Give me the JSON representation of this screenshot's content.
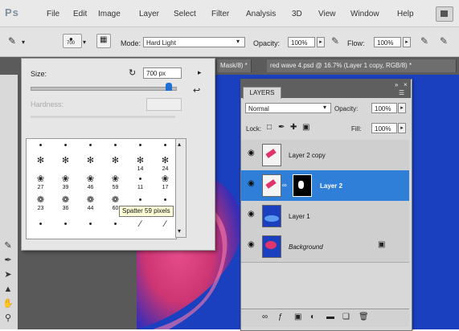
{
  "menu": {
    "logo": "Ps",
    "items": [
      "File",
      "Edit",
      "Image",
      "Layer",
      "Select",
      "Filter",
      "Analysis",
      "3D",
      "View",
      "Window",
      "Help"
    ]
  },
  "options": {
    "brush_size_small": "700",
    "mode_label": "Mode:",
    "mode_value": "Hard Light",
    "opacity_label": "Opacity:",
    "opacity_value": "100%",
    "flow_label": "Flow:",
    "flow_value": "100%"
  },
  "tabs": {
    "doc1": "Mask/8) *",
    "doc2": "red wave 4.psd @ 16.7% (Layer 1 copy, RGB/8) *"
  },
  "brush_picker": {
    "size_label": "Size:",
    "size_value": "700 px",
    "hardness_label": "Hardness:",
    "brushes": [
      {
        "num": ""
      },
      {
        "num": ""
      },
      {
        "num": ""
      },
      {
        "num": ""
      },
      {
        "num": ""
      },
      {
        "num": ""
      },
      {
        "num": ""
      },
      {
        "num": ""
      },
      {
        "num": ""
      },
      {
        "num": ""
      },
      {
        "num": "14"
      },
      {
        "num": "24"
      },
      {
        "num": "27"
      },
      {
        "num": "39"
      },
      {
        "num": "46"
      },
      {
        "num": "59"
      },
      {
        "num": "11"
      },
      {
        "num": "17"
      },
      {
        "num": "23"
      },
      {
        "num": "36"
      },
      {
        "num": "44"
      },
      {
        "num": "60"
      },
      {
        "num": "14"
      },
      {
        "num": "26"
      },
      {
        "num": ""
      },
      {
        "num": ""
      },
      {
        "num": ""
      },
      {
        "num": ""
      },
      {
        "num": ""
      },
      {
        "num": ""
      }
    ],
    "tooltip": "Spatter 59 pixels"
  },
  "layers": {
    "tab_label": "LAYERS",
    "blend_mode": "Normal",
    "opacity_label": "Opacity:",
    "opacity_value": "100%",
    "lock_label": "Lock:",
    "fill_label": "Fill:",
    "fill_value": "100%",
    "items": [
      {
        "name": "Layer 2 copy",
        "selected": false
      },
      {
        "name": "Layer 2",
        "selected": true
      },
      {
        "name": "Layer 1",
        "selected": false
      },
      {
        "name": "Background",
        "selected": false
      }
    ]
  },
  "colors": {
    "canvas_blue": "#1a3fbf",
    "selection_blue": "#2f7fd8",
    "panel_gray": "#d8d8d8"
  }
}
